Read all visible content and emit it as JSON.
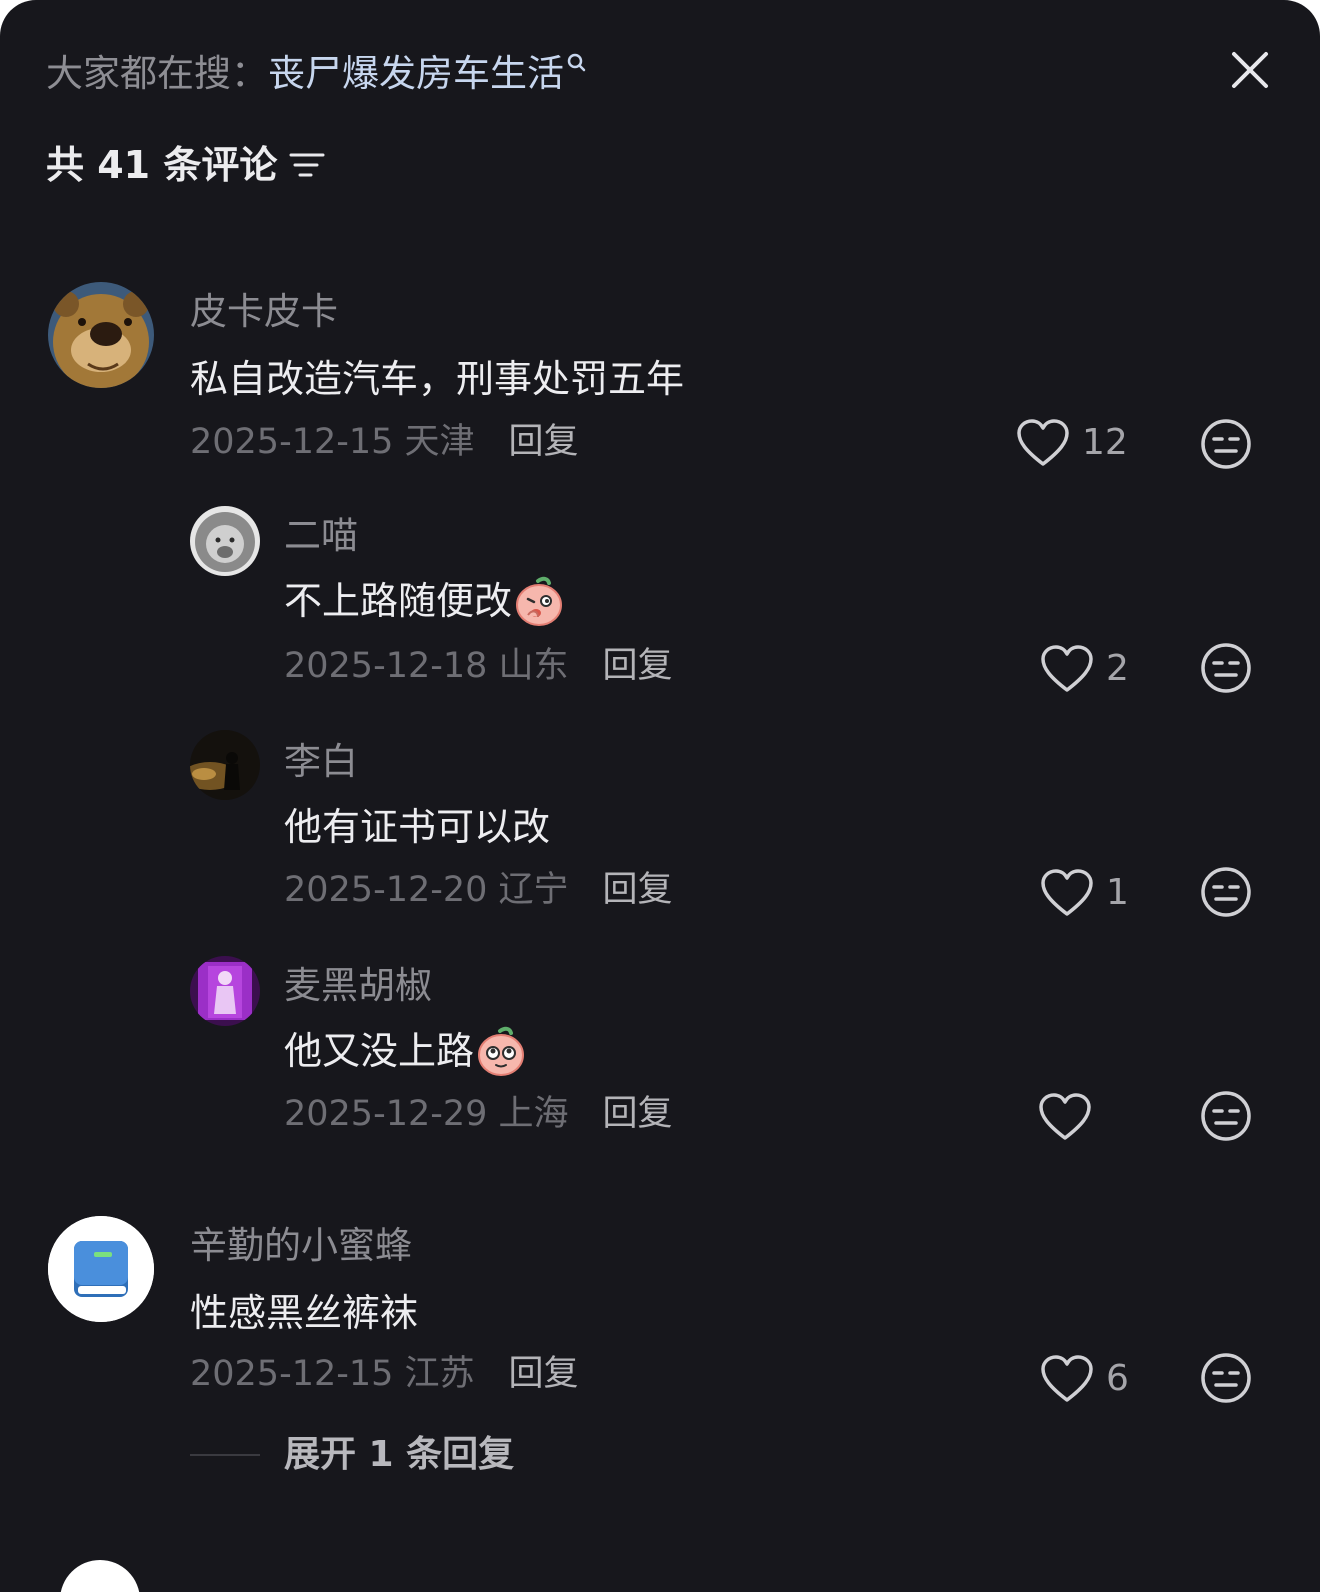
{
  "header": {
    "search_prefix": "大家都在搜：",
    "search_term": "丧尸爆发房车生活",
    "comment_count_label": "共 41 条评论"
  },
  "comments": [
    {
      "username": "皮卡皮卡",
      "text": "私自改造汽车，刑事处罚五年",
      "date_location": "2025-12-15 天津",
      "reply_label": "回复",
      "likes": "12",
      "avatar": "bear-avatar"
    },
    {
      "username": "二喵",
      "text": "不上路随便改",
      "emoji": "peach-face-emoji",
      "date_location": "2025-12-18 山东",
      "reply_label": "回复",
      "likes": "2",
      "avatar": "lion-avatar"
    },
    {
      "username": "李白",
      "text": "他有证书可以改",
      "date_location": "2025-12-20 辽宁",
      "reply_label": "回复",
      "likes": "1",
      "avatar": "silhouette-avatar"
    },
    {
      "username": "麦黑胡椒",
      "text": "他又没上路",
      "emoji": "peach-face-emoji",
      "date_location": "2025-12-29 上海",
      "reply_label": "回复",
      "likes": "",
      "avatar": "purple-avatar"
    },
    {
      "username": "辛勤的小蜜蜂",
      "text": "性感黑丝裤袜",
      "date_location": "2025-12-15 江苏",
      "reply_label": "回复",
      "likes": "6",
      "avatar": "book-avatar"
    }
  ],
  "expand_replies_label": "展开 1 条回复",
  "colors": {
    "background": "#17171c",
    "search_term": "#c7d6ee",
    "primary_text": "#ededf0",
    "secondary_text": "#8c8c92",
    "meta_text": "#6e6e74"
  }
}
